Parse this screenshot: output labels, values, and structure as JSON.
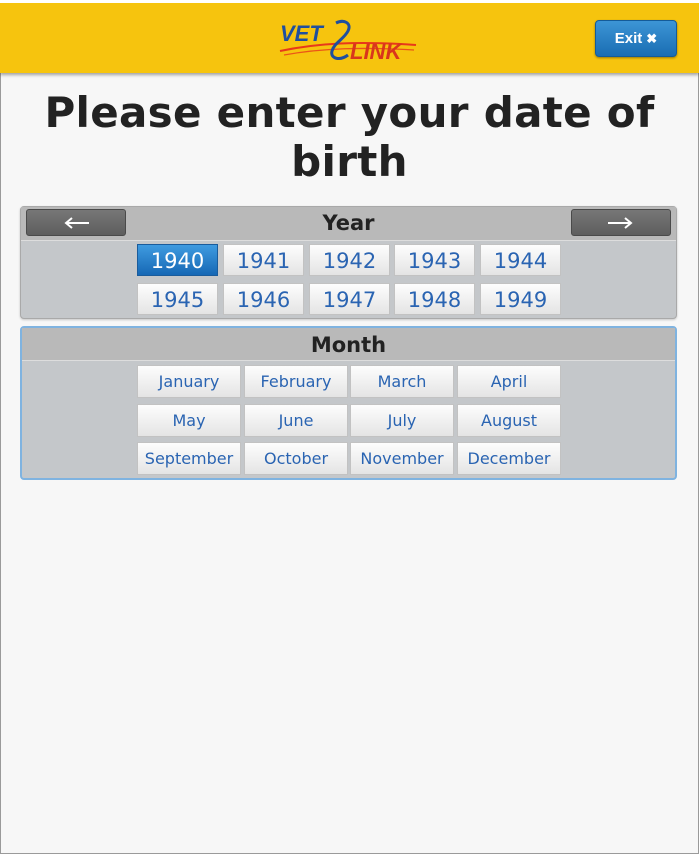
{
  "header": {
    "logo_text_top": "VET",
    "logo_text_bottom": "LINK",
    "exit_label": "Exit",
    "exit_icon": "✖"
  },
  "page": {
    "title": "Please enter your date of birth"
  },
  "year_selector": {
    "heading": "Year",
    "prev_icon": "arrow-left-icon",
    "next_icon": "arrow-right-icon",
    "selected": "1940",
    "years": [
      "1940",
      "1941",
      "1942",
      "1943",
      "1944",
      "1945",
      "1946",
      "1947",
      "1948",
      "1949"
    ]
  },
  "month_selector": {
    "heading": "Month",
    "months": [
      "January",
      "February",
      "March",
      "April",
      "May",
      "June",
      "July",
      "August",
      "September",
      "October",
      "November",
      "December"
    ]
  },
  "colors": {
    "header_bg": "#f6c40e",
    "accent": "#1a6db3",
    "link_text": "#2a64b2"
  }
}
